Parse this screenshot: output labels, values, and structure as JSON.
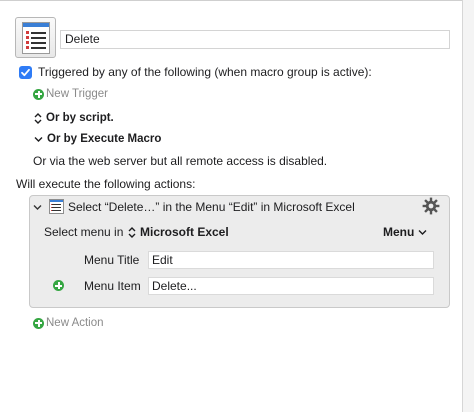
{
  "macro": {
    "name": "Delete",
    "icon": "list-document-icon"
  },
  "triggers": {
    "checkbox_checked": true,
    "label": "Triggered by any of the following (when macro group is active):",
    "new_trigger": "New Trigger",
    "script_label": "Or by script.",
    "execute_macro_label": "Or by Execute Macro",
    "web_server_text": "Or via the web server but all remote access is disabled."
  },
  "actions": {
    "header": "Will execute the following actions:",
    "items": [
      {
        "title": "Select “Delete…” in the Menu “Edit” in Microsoft Excel",
        "select_menu_label": "Select menu in",
        "app_name": "Microsoft Excel",
        "menu_dropdown": "Menu",
        "menu_title_label": "Menu Title",
        "menu_title_value": "Edit",
        "menu_item_label": "Menu Item",
        "menu_item_value": "Delete..."
      }
    ],
    "new_action": "New Action"
  },
  "colors": {
    "accent": "#2f7cf6",
    "add_green": "#35a642",
    "panel_bg": "#ececec"
  }
}
